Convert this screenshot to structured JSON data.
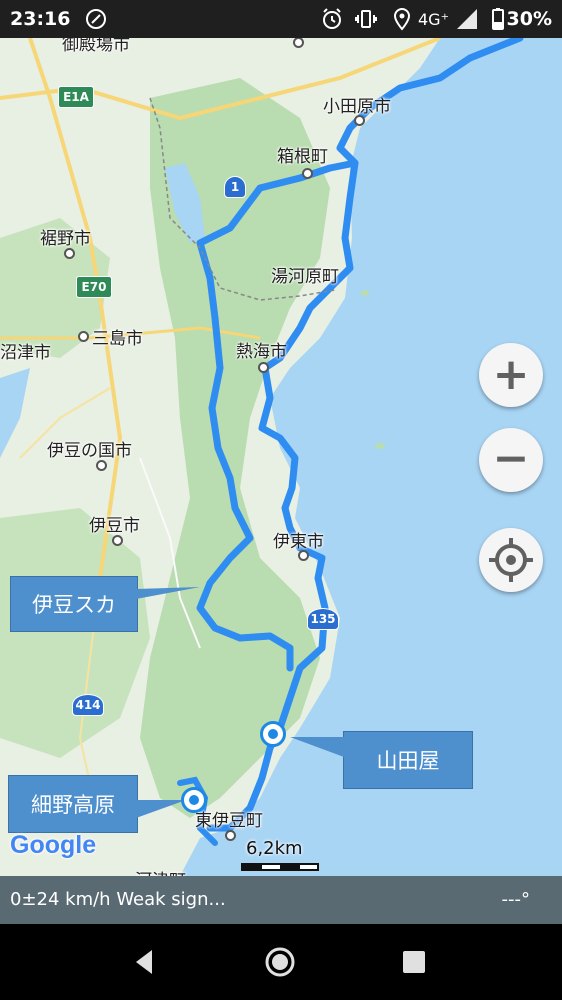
{
  "status_bar": {
    "time": "23:16",
    "network": "4G⁺",
    "battery": "30%",
    "icons": [
      "nfc-icon",
      "alarm-icon",
      "vibrate-icon",
      "location-icon",
      "signal-icon",
      "battery-icon"
    ]
  },
  "map": {
    "places": {
      "gotemba": "御殿場市",
      "odawara": "小田原市",
      "hakone": "箱根町",
      "susono": "裾野市",
      "yugawara": "湯河原町",
      "numazu": "沼津市",
      "mishima": "三島市",
      "atami": "熱海市",
      "izunokuni": "伊豆の国市",
      "izu": "伊豆市",
      "ito": "伊東市",
      "higashiizu": "東伊豆町",
      "kawazu": "河津町"
    },
    "road_shields": {
      "e1a": "E1A",
      "e70": "E70",
      "r1": "1",
      "r135": "135",
      "r414": "414"
    },
    "annotations": {
      "izu_skyline": "伊豆スカ",
      "yamadaya": "山田屋",
      "hosono_kogen": "細野高原"
    },
    "attribution": "Google",
    "scale_label": "6,2km",
    "colors": {
      "route": "#2f8cf0",
      "land": "#e8efe3",
      "forest": "#b9dcb0",
      "sea": "#a9d5f5",
      "road": "#f6d676"
    }
  },
  "controls": {
    "zoom_in": "+",
    "zoom_out": "−",
    "locate_icon": "crosshair-icon"
  },
  "bottom_bar": {
    "info": "0±24 km/h Weak sign...",
    "heading": "---°"
  },
  "nav_bar": {
    "buttons": [
      "back-icon",
      "home-icon",
      "recents-icon"
    ]
  }
}
